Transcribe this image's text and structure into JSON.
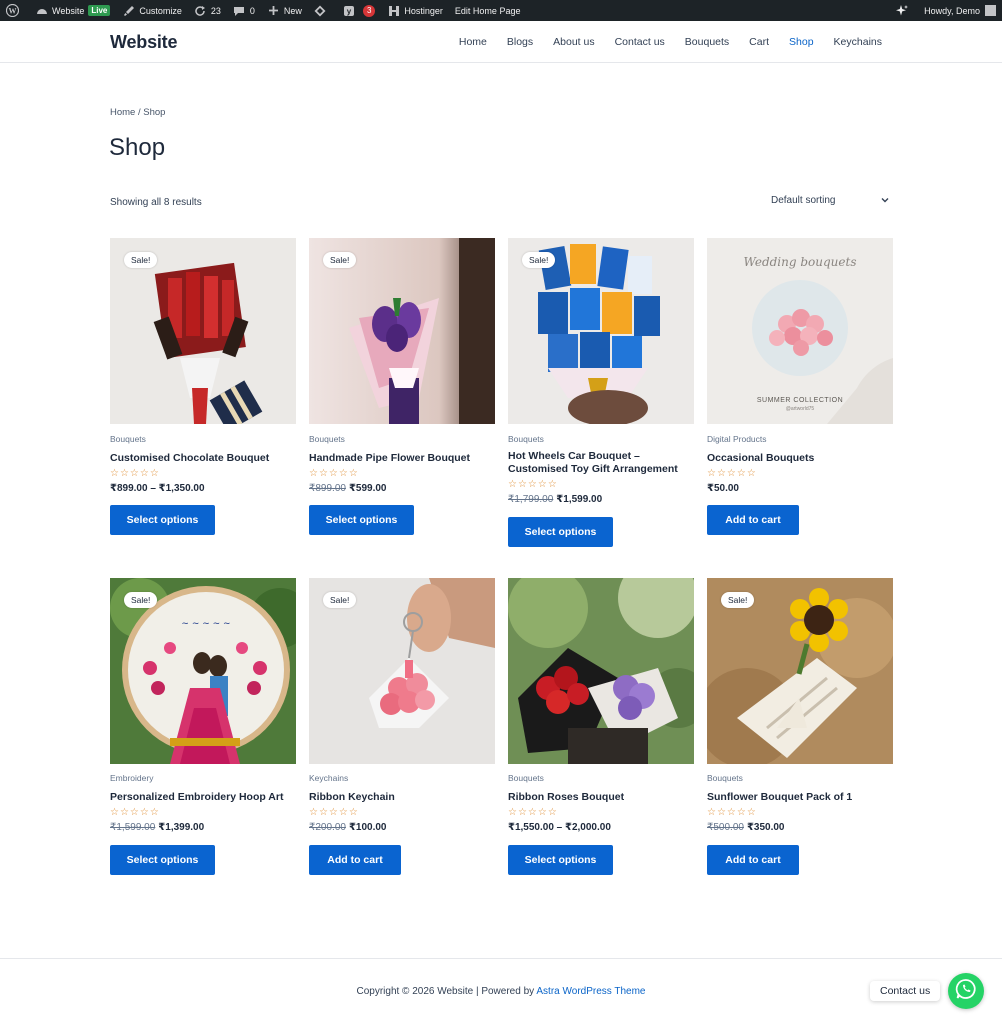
{
  "admin_bar": {
    "site_name": "Website",
    "live_badge": "Live",
    "customize": "Customize",
    "updates_count": "23",
    "comments_count": "0",
    "new_label": "New",
    "notifications_count": "3",
    "hostinger": "Hostinger",
    "edit_page": "Edit Home Page",
    "howdy": "Howdy, Demo"
  },
  "header": {
    "site_title": "Website",
    "nav": [
      {
        "label": "Home"
      },
      {
        "label": "Blogs"
      },
      {
        "label": "About us"
      },
      {
        "label": "Contact us"
      },
      {
        "label": "Bouquets"
      },
      {
        "label": "Cart"
      },
      {
        "label": "Shop"
      },
      {
        "label": "Keychains"
      }
    ],
    "active_nav": "Shop"
  },
  "main": {
    "breadcrumb": "Home / Shop",
    "title": "Shop",
    "result_count": "Showing all 8 results",
    "sorting": "Default sorting"
  },
  "products": [
    {
      "category": "Bouquets",
      "name": "Customised Chocolate Bouquet",
      "sale": "Sale!",
      "price": "₹899.00 – ₹1,350.00",
      "old_price": "",
      "button": "Select options"
    },
    {
      "category": "Bouquets",
      "name": "Handmade Pipe Flower Bouquet",
      "sale": "Sale!",
      "price": "₹599.00",
      "old_price": "₹899.00",
      "button": "Select options"
    },
    {
      "category": "Bouquets",
      "name": "Hot Wheels Car Bouquet – Customised Toy Gift Arrangement",
      "sale": "Sale!",
      "price": "₹1,599.00",
      "old_price": "₹1,799.00",
      "button": "Select options"
    },
    {
      "category": "Digital Products",
      "name": "Occasional Bouquets",
      "sale": "",
      "price": "₹50.00",
      "old_price": "",
      "button": "Add to cart",
      "image_text_top": "Wedding bouquets",
      "image_text_bottom": "SUMMER COLLECTION",
      "image_text_handle": "@artworld75"
    },
    {
      "category": "Embroidery",
      "name": "Personalized Embroidery Hoop Art",
      "sale": "Sale!",
      "price": "₹1,399.00",
      "old_price": "₹1,599.00",
      "button": "Select options"
    },
    {
      "category": "Keychains",
      "name": "Ribbon Keychain",
      "sale": "Sale!",
      "price": "₹100.00",
      "old_price": "₹200.00",
      "button": "Add to cart"
    },
    {
      "category": "Bouquets",
      "name": "Ribbon Roses Bouquet",
      "sale": "",
      "price": "₹1,550.00 – ₹2,000.00",
      "old_price": "",
      "button": "Select options"
    },
    {
      "category": "Bouquets",
      "name": "Sunflower Bouquet Pack of 1",
      "sale": "Sale!",
      "price": "₹350.00",
      "old_price": "₹500.00",
      "button": "Add to cart"
    }
  ],
  "rating_stars": "☆☆☆☆☆",
  "footer": {
    "copyright_prefix": "Copyright © 2026 Website | Powered by ",
    "theme_link": "Astra WordPress Theme",
    "contact_chip": "Contact us"
  },
  "colors": {
    "accent": "#0a64d0",
    "admin_bar": "#1d2327",
    "whatsapp": "#25d366",
    "live_badge": "#2e9a50",
    "star": "#e0913a"
  }
}
